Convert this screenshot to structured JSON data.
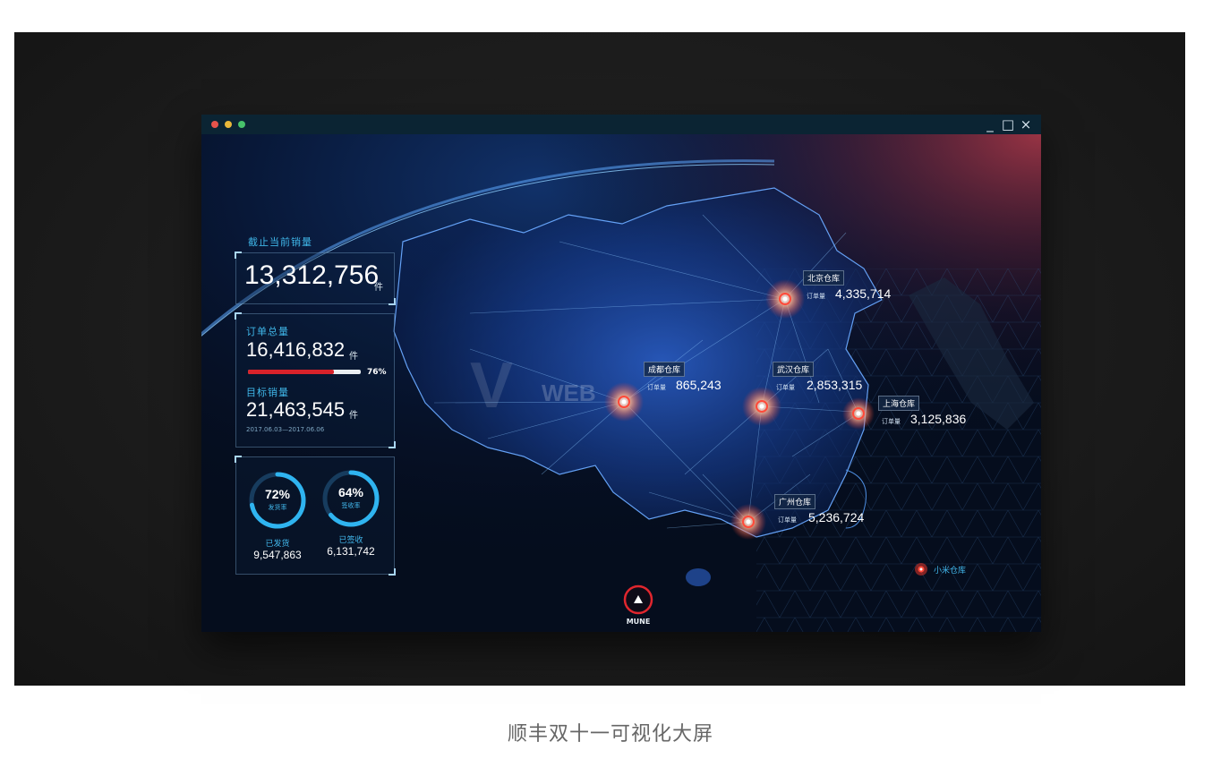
{
  "window": {
    "controls": {
      "minimize": "_",
      "maximize": "□",
      "close": "×"
    }
  },
  "stats": {
    "sales_label": "截止当前销量",
    "sales_value": "13,312,756",
    "sales_unit": "件",
    "orders_label": "订单总量",
    "orders_value": "16,416,832",
    "orders_unit": "件",
    "progress_percent": 76,
    "progress_label": "76%",
    "target_label": "目标销量",
    "target_value": "21,463,545",
    "target_unit": "件",
    "date_range": "2017.06.03—2017.06.06"
  },
  "rings": [
    {
      "percent": 72,
      "percent_label": "72%",
      "sub": "发货率",
      "title": "已发货",
      "value": "9,547,863"
    },
    {
      "percent": 64,
      "percent_label": "64%",
      "sub": "签收率",
      "title": "已签收",
      "value": "6,131,742"
    }
  ],
  "order_label": "订单量",
  "warehouses": [
    {
      "name": "北京仓库",
      "value": "4,335,714"
    },
    {
      "name": "成都仓库",
      "value": "865,243"
    },
    {
      "name": "武汉仓库",
      "value": "2,853,315"
    },
    {
      "name": "上海仓库",
      "value": "3,125,836"
    },
    {
      "name": "广州仓库",
      "value": "5,236,724"
    }
  ],
  "legend": {
    "label": "小米仓库"
  },
  "menu": {
    "label": "MUNE",
    "icon": "triangle-up-icon"
  },
  "watermark": "WEB",
  "caption": "顺丰双十一可视化大屏",
  "colors": {
    "accent_blue": "#41b6ea",
    "accent_red": "#d8222a",
    "background": "#061022"
  }
}
